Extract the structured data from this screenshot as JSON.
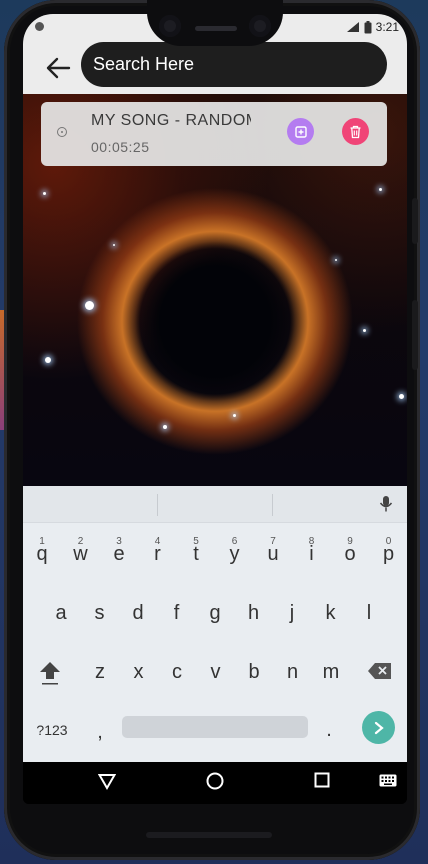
{
  "status_bar": {
    "time": "3:21",
    "icons": [
      "notification-dot",
      "signal-icon",
      "battery-icon"
    ]
  },
  "app_bar": {
    "back_icon": "arrow-left-icon",
    "search_placeholder": "Search Here"
  },
  "song_card": {
    "title": "MY SONG  - RANDOMSING",
    "duration": "00:05:25",
    "icons": [
      "disc-icon",
      "add-playlist-icon",
      "trash-icon"
    ],
    "colors": {
      "add": "#b47cf0",
      "delete": "#f04477"
    }
  },
  "keyboard": {
    "row1": [
      {
        "k": "q",
        "n": "1"
      },
      {
        "k": "w",
        "n": "2"
      },
      {
        "k": "e",
        "n": "3"
      },
      {
        "k": "r",
        "n": "4"
      },
      {
        "k": "t",
        "n": "5"
      },
      {
        "k": "y",
        "n": "6"
      },
      {
        "k": "u",
        "n": "7"
      },
      {
        "k": "i",
        "n": "8"
      },
      {
        "k": "o",
        "n": "9"
      },
      {
        "k": "p",
        "n": "0"
      }
    ],
    "row2": [
      "a",
      "s",
      "d",
      "f",
      "g",
      "h",
      "j",
      "k",
      "l"
    ],
    "row3": [
      "z",
      "x",
      "c",
      "v",
      "b",
      "n",
      "m"
    ],
    "symbols_label": "?123",
    "comma": ",",
    "period": ".",
    "enter_color": "#4eb6a7"
  },
  "nav_bar": {
    "icons": [
      "back-triangle-icon",
      "home-circle-icon",
      "recents-square-icon",
      "keyboard-icon"
    ]
  }
}
